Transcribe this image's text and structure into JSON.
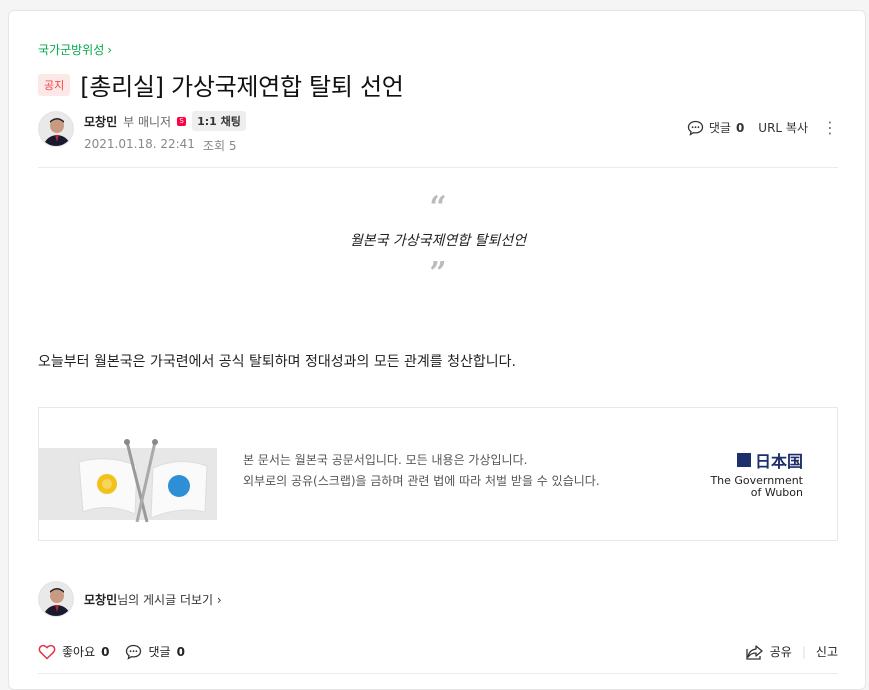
{
  "category": "국가군방위성",
  "post": {
    "badge": "공지",
    "title": "[총리실] 가상국제연합 탈퇴 선언",
    "author": "모창민",
    "role": "부 매니저",
    "role_icon_letter": "S",
    "chat_label": "1:1 채팅",
    "date": "2021.01.18. 22:41",
    "views_label": "조회 5"
  },
  "tools": {
    "comment_label": "댓글",
    "comment_count": "0",
    "url_copy": "URL 복사"
  },
  "quote": {
    "open_mark": "“",
    "text": "월본국 가상국제연합 탈퇴선언",
    "close_mark": "”"
  },
  "body_text": "오늘부터 월본국은 가국련에서 공식 탈퇴하며 정대성과의 모든 관계를 청산합니다.",
  "banner": {
    "line1": "본 문서는 월본국 공문서입니다. 모든 내용은 가상입니다.",
    "line2": "외부로의 공유(스크랩)을 금하며 관련 법에 따라 처벌 받을 수 있습니다.",
    "gov_kanji": "日本国",
    "gov_en1": "The Government",
    "gov_en2": "of Wubon"
  },
  "more_posts": {
    "author": "모창민",
    "suffix": "님의 게시글 더보기"
  },
  "bottom": {
    "like_label": "좋아요",
    "like_count": "0",
    "comment_label": "댓글",
    "comment_count": "0",
    "share_label": "공유",
    "report_label": "신고"
  },
  "icons": [
    "chevron-right-icon",
    "comment-icon",
    "more-dots-icon",
    "heart-icon",
    "share-icon"
  ],
  "colors": {
    "category": "#03a94d",
    "badge_bg": "#fde8e8",
    "badge_text": "#ee4444",
    "gov_blue": "#1c2e6b",
    "heart": "#e4344a"
  }
}
